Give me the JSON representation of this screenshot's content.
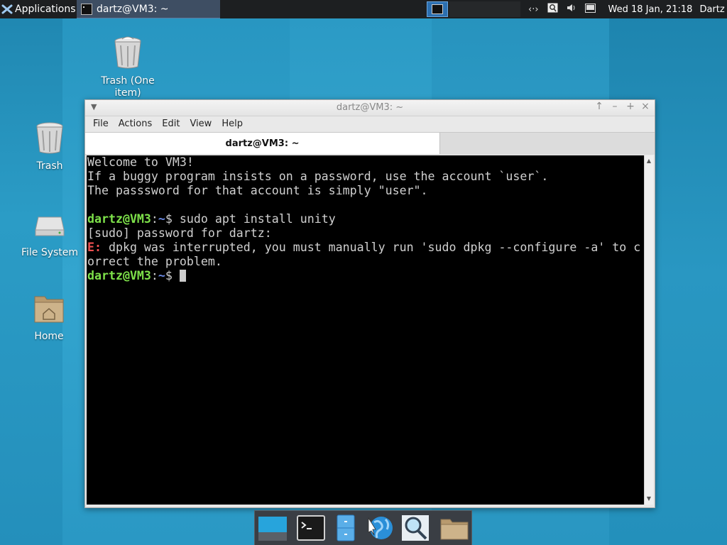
{
  "top_panel": {
    "applications_label": "Applications",
    "task": {
      "label": "dartz@VM3: ~"
    },
    "clock": "Wed 18 Jan, 21:18",
    "user": "Dartz"
  },
  "desktop": {
    "icons": [
      {
        "label": "Trash (One item)"
      },
      {
        "label": "Trash"
      },
      {
        "label": "File System"
      },
      {
        "label": "Home"
      }
    ]
  },
  "window": {
    "title": "dartz@VM3: ~",
    "menu": [
      "File",
      "Actions",
      "Edit",
      "View",
      "Help"
    ],
    "tab_label": "dartz@VM3: ~",
    "terminal": {
      "line1": "Welcome to VM3!",
      "line2": "If a buggy program insists on a password, use the account `user`.",
      "line3": "The passsword for that account is simply \"user\".",
      "prompt_user": "dartz@VM3",
      "prompt_colon": ":",
      "prompt_path": "~",
      "prompt_dollar": "$ ",
      "command": "sudo apt install unity",
      "line5": "[sudo] password for dartz:",
      "error_prefix": "E:",
      "error_text": " dpkg was interrupted, you must manually run 'sudo dpkg --configure -a' to c",
      "line7": "orrect the problem."
    }
  },
  "dock": {
    "items": [
      "desktop",
      "terminal",
      "file-manager",
      "web-browser",
      "search",
      "folder"
    ]
  },
  "colors": {
    "desktop": "#2a95bf",
    "panel": "#1d1f21",
    "prompt_user": "#7ee24a",
    "prompt_path": "#6c8be6",
    "error": "#f05050"
  }
}
